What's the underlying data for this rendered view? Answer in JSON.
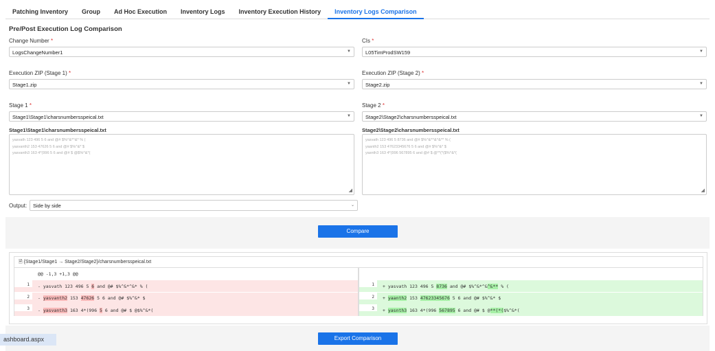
{
  "tabs": [
    "Patching Inventory",
    "Group",
    "Ad Hoc Execution",
    "Inventory Logs",
    "Inventory Execution History",
    "Inventory Logs Comparison"
  ],
  "page_title": "Pre/Post Execution Log Comparison",
  "required_mark": "*",
  "fields": {
    "change_number": {
      "label": "Change Number",
      "value": "LogsChangeNumber1"
    },
    "cis": {
      "label": "CIs",
      "value": "L05TimProdSW159"
    },
    "zip1": {
      "label": "Execution ZIP (Stage 1)",
      "value": "Stage1.zip"
    },
    "zip2": {
      "label": "Execution ZIP (Stage 2)",
      "value": "Stage2.zip"
    },
    "stage1": {
      "label": "Stage 1",
      "value": "Stage1\\Stage1\\charsnumbersspeical.txt"
    },
    "stage2": {
      "label": "Stage 2",
      "value": "Stage2\\Stage2\\charsnumbersspeical.txt"
    }
  },
  "text1": {
    "title": "Stage1\\Stage1\\charsnumbersspeical.txt",
    "lines": [
      "yasvath 123 496 5 6 and @# $%^&*^&* % (",
      "yasvanth2 153 47626 5 6 and @# $%^&* $",
      "yasvanth3 163 4*(996 5 6 and @# $ @$%^&*("
    ]
  },
  "text2": {
    "title": "Stage2\\Stage2\\charsnumbersspeical.txt",
    "lines": [
      "yasvath 123 496 5 8736 and @# $%^&*^&^&** % (",
      "yaanth2 153 47623345676 5 6 and @# $%^&* $",
      "yasnth3 163 4*(996 567895 6 and @# $ @**(*($%^&*("
    ]
  },
  "output": {
    "label": "Output:",
    "value": "Side by side"
  },
  "compare_label": "Compare",
  "export_label": "Export Comparison",
  "diff": {
    "file_title": "{Stage1/Stage1 → Stage2/Stage2}/charsnumbersspeical.txt",
    "hunk": "@@ -1,3 +1,3 @@",
    "left": [
      {
        "n": "1",
        "segs": [
          [
            "- yasvath 123 496 5 ",
            0
          ],
          [
            "6",
            1
          ],
          [
            " and @# $%^&*^&* % (",
            0
          ]
        ]
      },
      {
        "n": "2",
        "segs": [
          [
            "- ",
            0
          ],
          [
            "yasvanth2",
            1
          ],
          [
            " 153 ",
            0
          ],
          [
            "47626",
            1
          ],
          [
            " 5 6 and @# $%^&* $",
            0
          ]
        ]
      },
      {
        "n": "3",
        "segs": [
          [
            "- ",
            0
          ],
          [
            "yasvanth3",
            1
          ],
          [
            " 163 4*(996 ",
            0
          ],
          [
            "5",
            1
          ],
          [
            " 6 and @# $ @$%^&*(",
            0
          ]
        ]
      }
    ],
    "right": [
      {
        "n": "1",
        "segs": [
          [
            "+ yasvath 123 496 5 ",
            0
          ],
          [
            "8736",
            1
          ],
          [
            " and @# $%^&*^&",
            0
          ],
          [
            "^&",
            1
          ],
          [
            "**",
            1
          ],
          [
            " % (",
            0
          ]
        ]
      },
      {
        "n": "2",
        "segs": [
          [
            "+ ",
            0
          ],
          [
            "yaanth2",
            1
          ],
          [
            " 153 ",
            0
          ],
          [
            "47623345676",
            1
          ],
          [
            " 5 6 and @# $%^&* $",
            0
          ]
        ]
      },
      {
        "n": "3",
        "segs": [
          [
            "+ ",
            0
          ],
          [
            "yasnth3",
            1
          ],
          [
            " 163 4*(996 ",
            0
          ],
          [
            "567895",
            1
          ],
          [
            " 6 and @# $ @",
            0
          ],
          [
            "**(*(",
            1
          ],
          [
            "$%^&*(",
            0
          ]
        ]
      }
    ]
  },
  "status_tooltip": "ashboard.aspx"
}
